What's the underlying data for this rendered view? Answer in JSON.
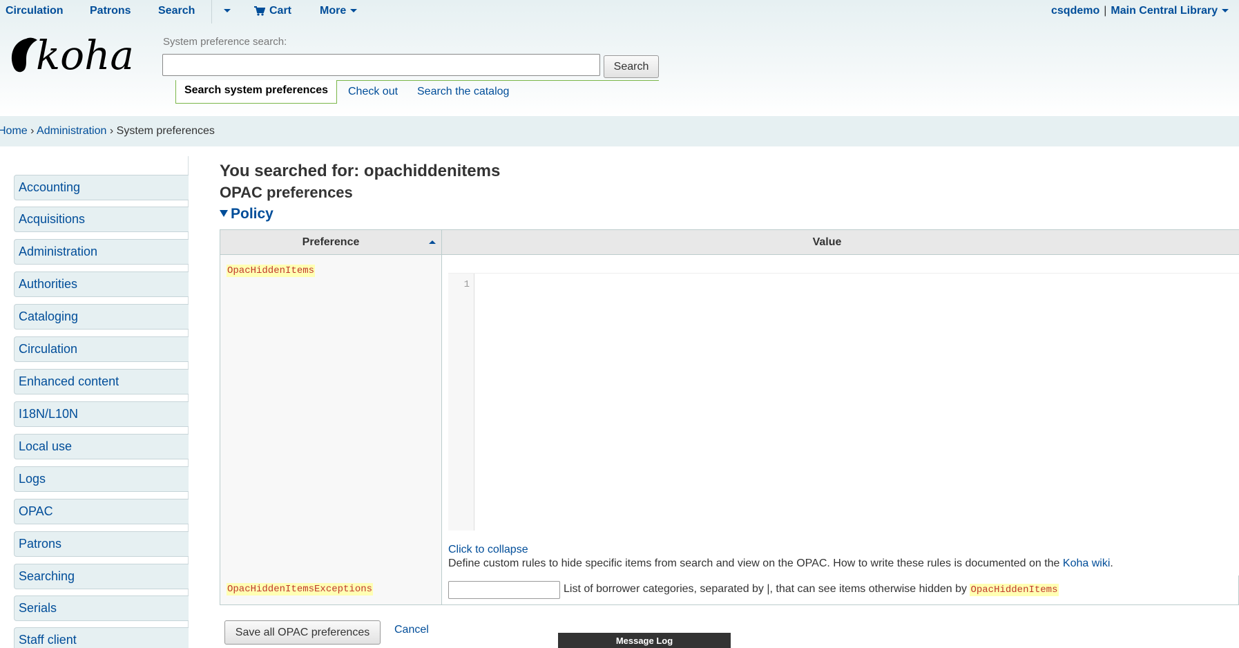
{
  "topnav": {
    "circulation": "Circulation",
    "patrons": "Patrons",
    "search": "Search",
    "cart": "Cart",
    "more": "More",
    "user": "csqdemo",
    "separator": "|",
    "library": "Main Central Library"
  },
  "logo": {
    "text": "koha"
  },
  "search": {
    "label": "System preference search:",
    "value": "",
    "button": "Search",
    "tabs": [
      "Search system preferences",
      "Check out",
      "Search the catalog"
    ]
  },
  "breadcrumb": {
    "home": "Home",
    "admin": "Administration",
    "current": "System preferences",
    "sep": "›"
  },
  "sidebar": {
    "items": [
      "Accounting",
      "Acquisitions",
      "Administration",
      "Authorities",
      "Cataloging",
      "Circulation",
      "Enhanced content",
      "I18N/L10N",
      "Local use",
      "Logs",
      "OPAC",
      "Patrons",
      "Searching",
      "Serials",
      "Staff client"
    ]
  },
  "main": {
    "search_heading": "You searched for: opachiddenitems",
    "section_heading": "OPAC preferences",
    "group_heading": "Policy",
    "table": {
      "col_preference": "Preference",
      "col_value": "Value"
    },
    "row1": {
      "pref": "OpacHiddenItems",
      "line_number": "1",
      "collapse": "Click to collapse",
      "desc_before": "Define custom rules to hide specific items from search and view on the OPAC. How to write these rules is documented on the ",
      "desc_link": "Koha wiki",
      "desc_after": "."
    },
    "row2": {
      "pref": "OpacHiddenItemsExceptions",
      "value": "",
      "desc_before": "List of borrower categories, separated by |, that can see items otherwise hidden by ",
      "desc_code": "OpacHiddenItems"
    },
    "save": "Save all OPAC preferences",
    "cancel": "Cancel"
  },
  "message_log": "Message Log",
  "colors": {
    "link": "#004d99",
    "accent": "#7ab648",
    "pref_bg": "#ffffb3"
  }
}
